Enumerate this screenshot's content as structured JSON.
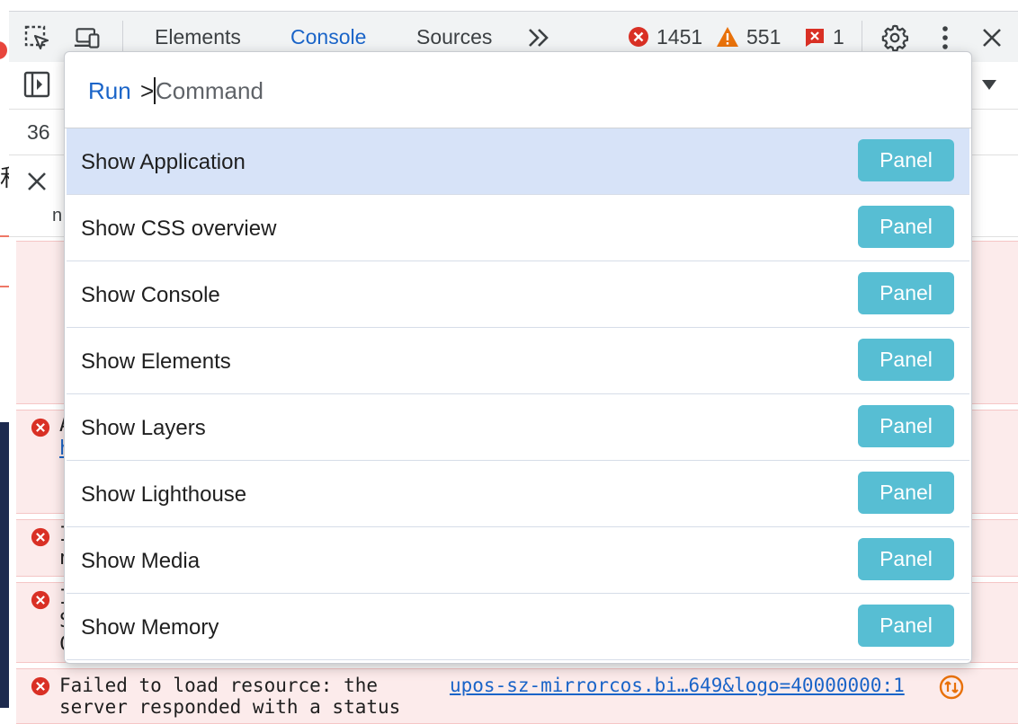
{
  "toolbar": {
    "tabs": [
      {
        "label": "Elements",
        "active": false
      },
      {
        "label": "Console",
        "active": true
      },
      {
        "label": "Sources",
        "active": false
      }
    ],
    "overflow_icon": "chevron-double-right-icon",
    "errors_count": "1451",
    "warnings_count": "551",
    "issues_count": "1"
  },
  "console": {
    "messages_count_partial": "36",
    "filter_partial": "n",
    "cjk_partial": "和",
    "error_row_peeks": [
      {
        "line1": "A",
        "line2": "h"
      },
      {
        "line1": "I",
        "line2": "n"
      },
      {
        "line1": "I",
        "line2": "S",
        "line3": "C"
      }
    ],
    "last_error": {
      "message": "Failed to load resource: the\nserver responded with a status",
      "link": "upos-sz-mirrorcos.bi…649&logo=40000000:1"
    }
  },
  "command_menu": {
    "prefix": "Run",
    "prompt": ">",
    "placeholder": "Command",
    "items": [
      {
        "label": "Show Application",
        "tag": "Panel",
        "selected": true
      },
      {
        "label": "Show CSS overview",
        "tag": "Panel",
        "selected": false
      },
      {
        "label": "Show Console",
        "tag": "Panel",
        "selected": false
      },
      {
        "label": "Show Elements",
        "tag": "Panel",
        "selected": false
      },
      {
        "label": "Show Layers",
        "tag": "Panel",
        "selected": false
      },
      {
        "label": "Show Lighthouse",
        "tag": "Panel",
        "selected": false
      },
      {
        "label": "Show Media",
        "tag": "Panel",
        "selected": false
      },
      {
        "label": "Show Memory",
        "tag": "Panel",
        "selected": false
      }
    ]
  },
  "colors": {
    "accent_blue": "#1a64c8",
    "selected_row": "#d7e3f8",
    "panel_tag": "#57bed3",
    "error_bg": "#fcebeb",
    "error_red": "#d93025",
    "warning_orange": "#e8710a"
  }
}
